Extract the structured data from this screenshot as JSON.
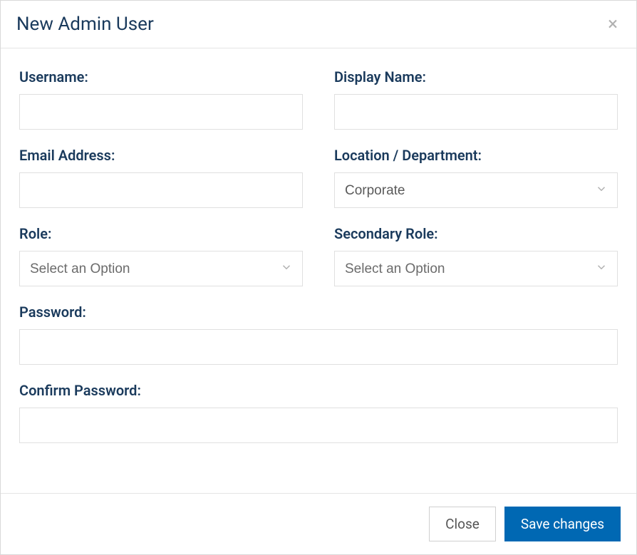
{
  "modal": {
    "title": "New Admin User"
  },
  "fields": {
    "username": {
      "label": "Username:",
      "value": ""
    },
    "displayName": {
      "label": "Display Name:",
      "value": ""
    },
    "email": {
      "label": "Email Address:",
      "value": ""
    },
    "location": {
      "label": "Location / Department:",
      "value": "Corporate"
    },
    "role": {
      "label": "Role:",
      "value": "",
      "placeholder": "Select an Option"
    },
    "secondaryRole": {
      "label": "Secondary Role:",
      "value": "",
      "placeholder": "Select an Option"
    },
    "password": {
      "label": "Password:",
      "value": ""
    },
    "confirmPassword": {
      "label": "Confirm Password:",
      "value": ""
    }
  },
  "footer": {
    "close": "Close",
    "save": "Save changes"
  }
}
